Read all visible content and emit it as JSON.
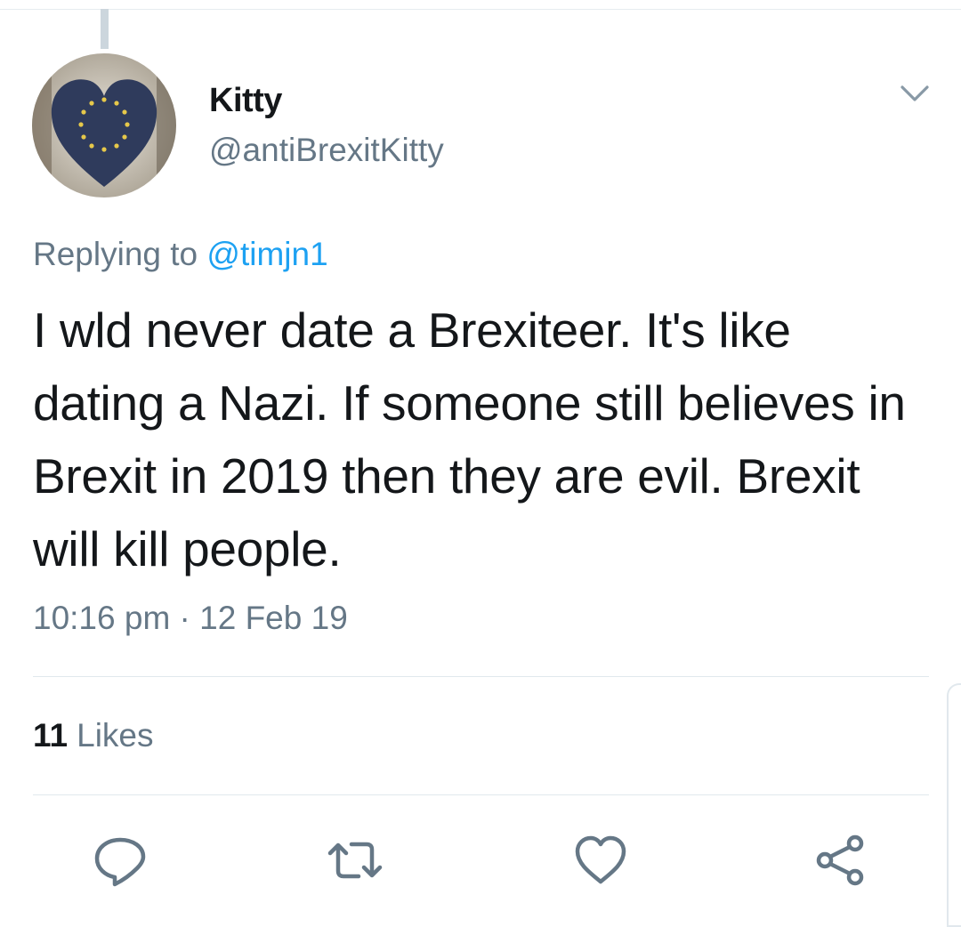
{
  "tweet": {
    "display_name": "Kitty",
    "handle": "@antiBrexitKitty",
    "replying_prefix": "Replying to",
    "replying_to": "@timjn1",
    "text": "I wld never date a Brexiteer. It's like dating a Nazi. If someone still believes in Brexit in 2019 then they are evil. Brexit will kill people.",
    "timestamp": "10:16 pm · 12 Feb 19"
  },
  "stats": {
    "likes_count": "11",
    "likes_label": "Likes"
  },
  "actions": [
    {
      "icon": "reply-icon"
    },
    {
      "icon": "retweet-icon"
    },
    {
      "icon": "like-icon"
    },
    {
      "icon": "share-icon"
    }
  ],
  "colors": {
    "text_primary": "#14171a",
    "text_secondary": "#657786",
    "link": "#1da1f2",
    "divider": "#e1e8ed",
    "avatar_heart": "#2f3b5c",
    "avatar_stars": "#e6c84a"
  }
}
